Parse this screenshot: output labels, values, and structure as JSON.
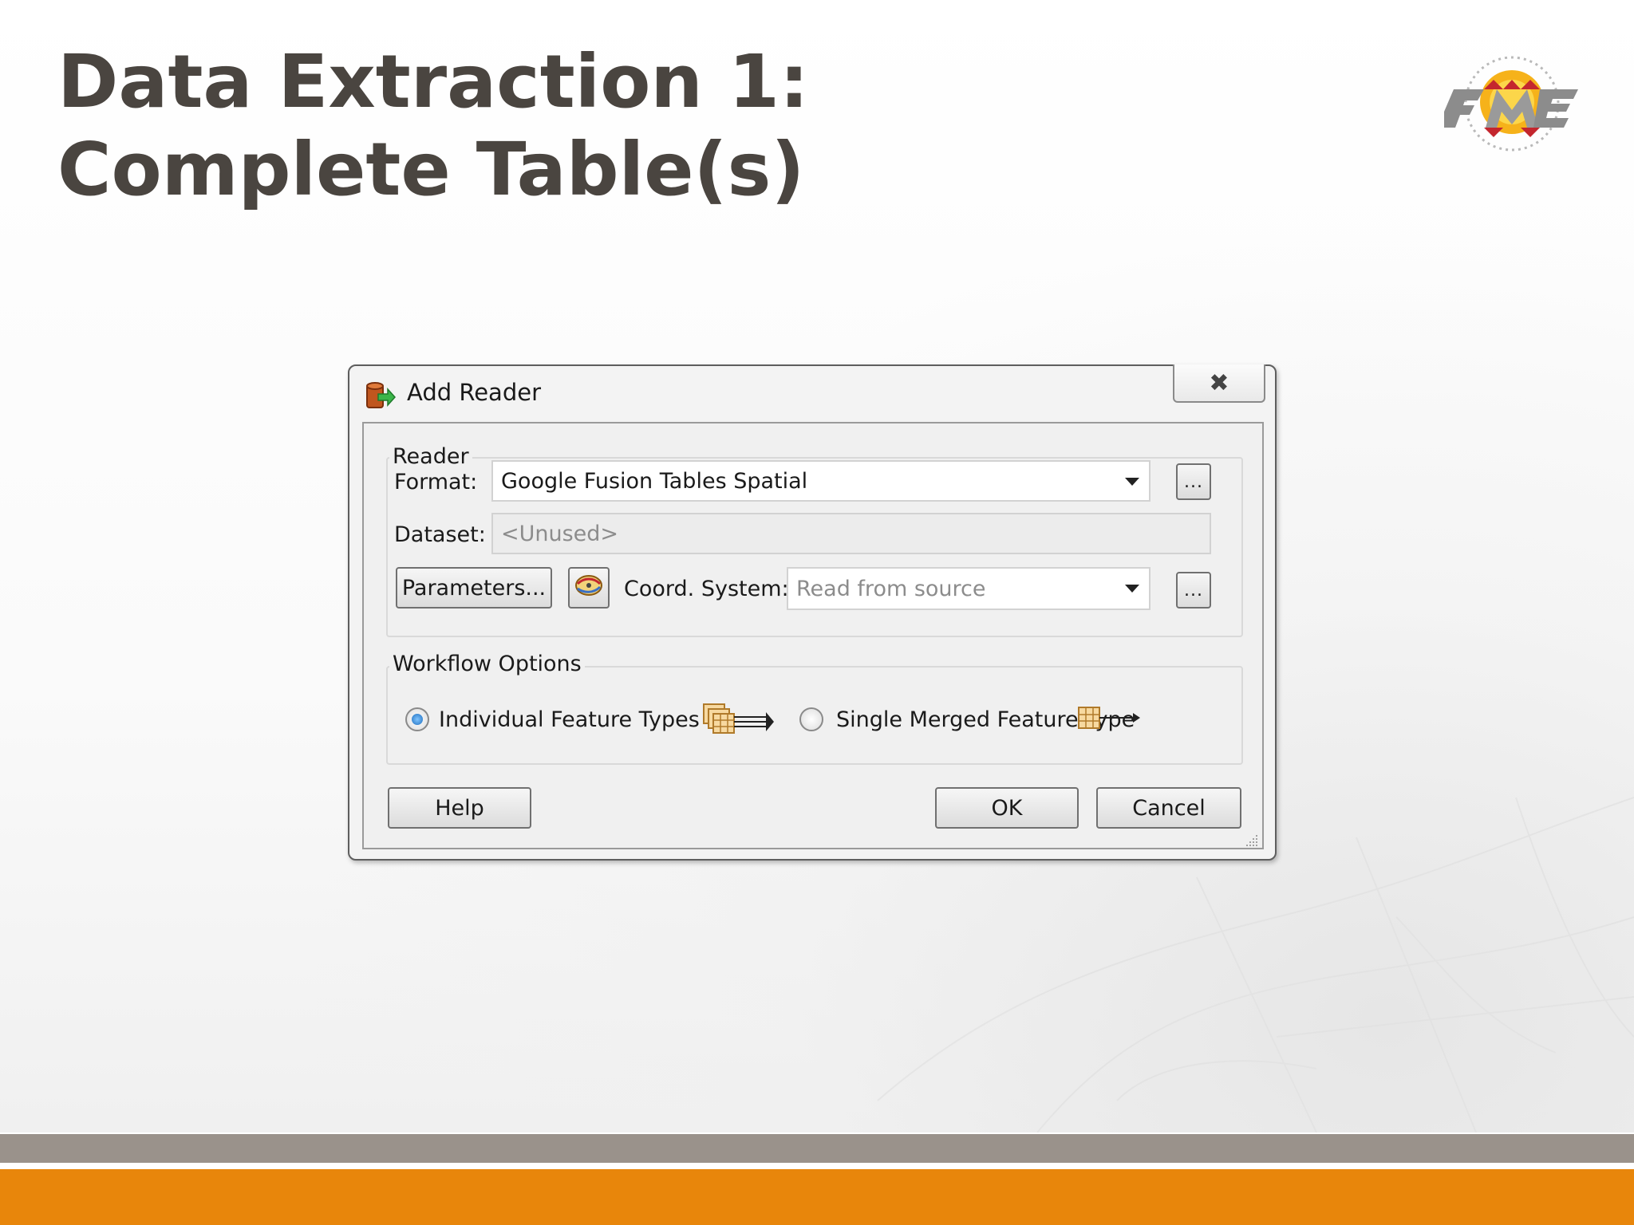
{
  "slide": {
    "title_line1": "Data Extraction 1:",
    "title_line2": "Complete Table(s)",
    "logo": "fme-logo",
    "colors": {
      "title": "#4a4540",
      "footer_gray": "#9a928b",
      "footer_orange": "#e8860b"
    }
  },
  "dialog": {
    "title": "Add Reader",
    "close_icon": "close-icon",
    "reader_group": {
      "label": "Reader",
      "format_label": "Format:",
      "format_value": "Google Fusion Tables Spatial",
      "format_browse": "...",
      "dataset_label": "Dataset:",
      "dataset_value": "<Unused>",
      "parameters_button": "Parameters...",
      "coord_system_icon": "coordinate-system-icon",
      "coord_label": "Coord. System:",
      "coord_value": "Read from source",
      "coord_browse": "..."
    },
    "workflow_group": {
      "label": "Workflow Options",
      "option_individual": "Individual Feature Types",
      "option_individual_selected": true,
      "option_single": "Single Merged Feature Type",
      "option_single_selected": false
    },
    "buttons": {
      "help": "Help",
      "ok": "OK",
      "cancel": "Cancel"
    }
  }
}
